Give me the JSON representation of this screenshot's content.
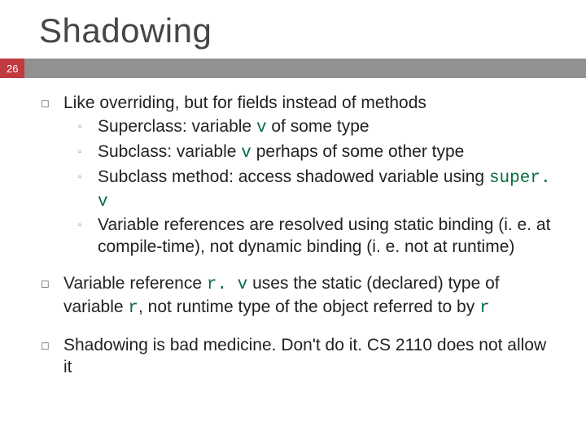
{
  "slide": {
    "title": "Shadowing",
    "page_number": "26",
    "markers": {
      "square_open": "◻",
      "square_small": "▫"
    },
    "bullets": [
      {
        "lead": "Like overriding, but for fields instead of methods",
        "subs": [
          {
            "pre": "Superclass: variable ",
            "code": "v",
            "post": " of some type"
          },
          {
            "pre": "Subclass: variable ",
            "code": "v",
            "post": " perhaps of some other type"
          },
          {
            "pre": "Subclass method: access shadowed variable using ",
            "code": "super. v",
            "post": ""
          },
          {
            "pre": "",
            "code": "",
            "post": "Variable references are resolved using static binding (i. e. at compile-time), not dynamic binding (i. e. not at runtime)"
          }
        ]
      },
      {
        "segments": [
          {
            "t": "Variable reference "
          },
          {
            "t": "r. v",
            "code": true
          },
          {
            "t": " uses the static (declared) type of variable "
          },
          {
            "t": "r",
            "code": true
          },
          {
            "t": ", not runtime type of the object referred to by "
          },
          {
            "t": "r",
            "code": true
          }
        ]
      },
      {
        "lead": "Shadowing is bad medicine. Don't do it. CS 2110 does not allow it"
      }
    ]
  }
}
